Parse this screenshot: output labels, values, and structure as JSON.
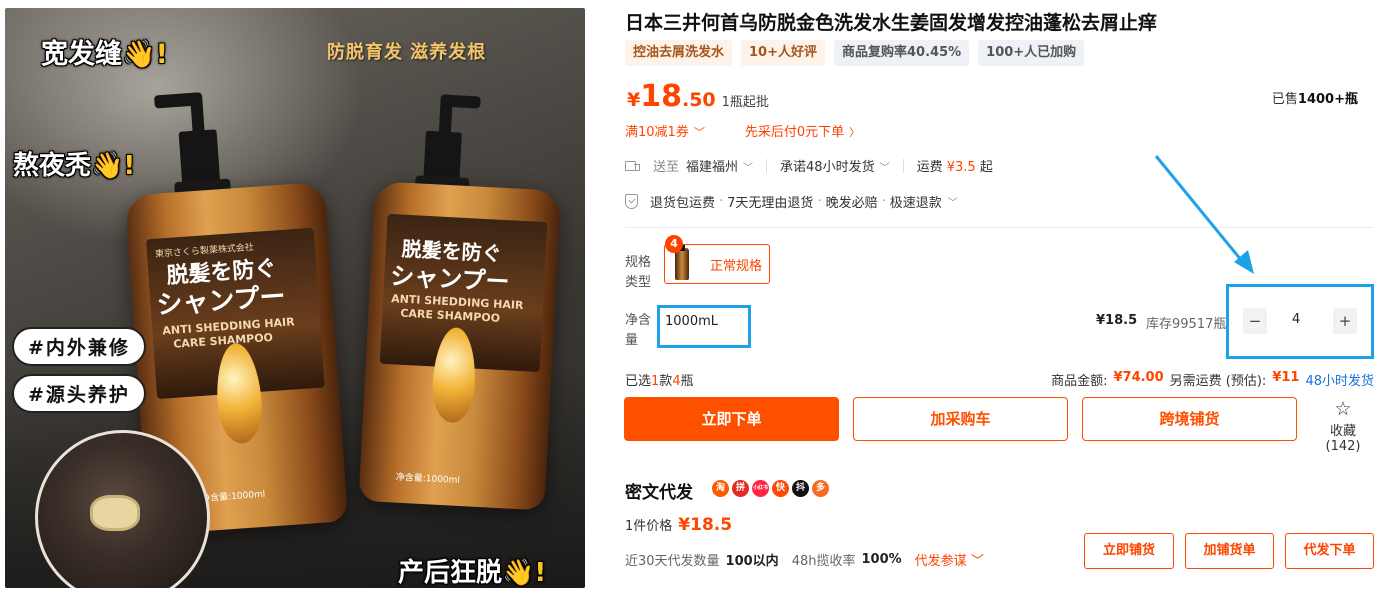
{
  "image": {
    "overlay_top_left": "宽发缝",
    "overlay_mid_left": "熬夜秃",
    "overlay_top_right": "防脱育发 滋养发根",
    "tags": [
      "#内外兼修",
      "#源头养护"
    ],
    "overlay_bottom_right": "产后狂脱",
    "wave_emoji": "👋!",
    "bottle_jp_line1": "脱髪を防ぐ",
    "bottle_jp_line2": "シャンプー",
    "bottle_en_line1": "ANTI SHEDDING HAIR",
    "bottle_en_line2": "CARE SHAMPOO",
    "bottle_volume": "净含量:1000ml",
    "bottle_brand": "東京さくら製薬株式会社"
  },
  "product": {
    "title": "日本三井何首乌防脱金色洗发水生姜固发增发控油蓬松去屑止痒",
    "badges": [
      {
        "label": "控油去屑洗发水",
        "style": "orange"
      },
      {
        "label": "10+人好评",
        "style": "orange"
      },
      {
        "label": "商品复购率40.45%",
        "style": "gray"
      },
      {
        "label": "100+人已加购",
        "style": "gray"
      }
    ]
  },
  "price": {
    "symbol": "¥",
    "integer": "18",
    "decimal": ".50",
    "note": "1瓶起批",
    "sold_prefix": "已售",
    "sold_value": "1400+瓶"
  },
  "promo": {
    "coupon": "满10减1券",
    "pay_later": "先采后付0元下单"
  },
  "shipping": {
    "send_label": "送至",
    "location": "福建福州",
    "promise": "承诺48小时发货",
    "fee_label": "运费",
    "fee_value": "¥3.5",
    "fee_suffix": "起"
  },
  "guarantees": {
    "items": [
      "退货包运费",
      "7天无理由退货",
      "晚发必赔",
      "极速退款"
    ],
    "dot": "·"
  },
  "spec": {
    "label": "规格类型",
    "count": "4",
    "option": "正常规格",
    "net_label": "净含量",
    "net_value": "1000mL",
    "unit_price": "¥18.5",
    "stock": "库存99517瓶"
  },
  "stepper": {
    "minus": "−",
    "value": "4",
    "plus": "+"
  },
  "summary": {
    "selected_prefix": "已选",
    "selected_kinds": "1",
    "selected_mid": "款",
    "selected_qty": "4",
    "selected_unit": "瓶",
    "amount_label": "商品金额:",
    "amount_value": "¥74.00",
    "extra_label": "另需运费 (预估):",
    "extra_value": "¥11",
    "ship_link": "48小时发货"
  },
  "actions": {
    "buy_now": "立即下单",
    "add_cart": "加采购车",
    "cross_border": "跨境铺货",
    "favorite_icon": "star-outline",
    "favorite": "收藏 (142)"
  },
  "dropship": {
    "title": "密文代发",
    "platforms": [
      {
        "name": "淘",
        "color": "#ff5a00"
      },
      {
        "name": "拼",
        "color": "#e02e24"
      },
      {
        "name": "小红书",
        "color": "#ff2442"
      },
      {
        "name": "快",
        "color": "#ff4906"
      },
      {
        "name": "抖",
        "color": "#111111"
      },
      {
        "name": "多",
        "color": "#f36c21"
      }
    ],
    "unit_label": "1件价格",
    "unit_price": "¥18.5",
    "stats_label1": "近30天代发数量",
    "stats_value1": "100以内",
    "stats_label2": "48h揽收率",
    "stats_value2": "100%",
    "ref_link": "代发参谋",
    "btn_list": "立即铺货",
    "btn_add": "加铺货单",
    "btn_order": "代发下单"
  },
  "colors": {
    "accent": "#ff5000",
    "highlight": "#1da1e8"
  }
}
